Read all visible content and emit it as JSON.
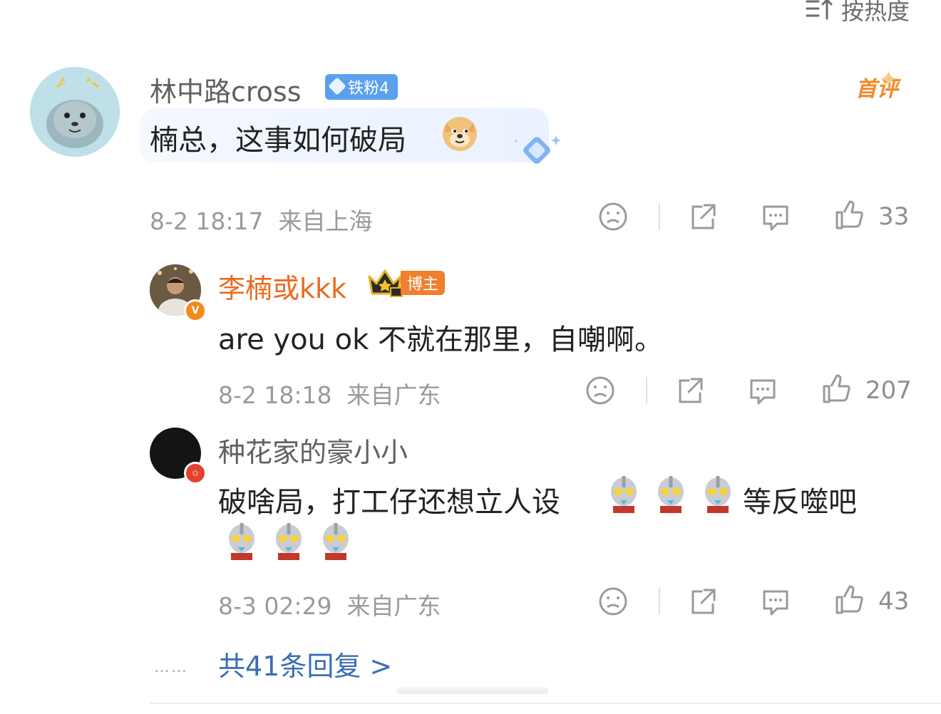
{
  "sort": {
    "label": "按热度"
  },
  "comments": [
    {
      "username": "林中路cross",
      "badge": "铁粉4",
      "tag": "首评",
      "text": "楠总，这事如何破局",
      "time": "8-2 18:17",
      "location": "来自上海",
      "likes": "33"
    },
    {
      "username": "李楠或kkk",
      "badge": "博主",
      "verified_label": "V",
      "text": "are you ok 不就在那里，自嘲啊。",
      "time": "8-2 18:18",
      "location": "来自广东",
      "likes": "207"
    },
    {
      "username": "种花家的豪小小",
      "text_line1": "破啥局，打工仔还想立人设",
      "text_line1_suffix": "等反噬吧",
      "time": "8-3 02:29",
      "location": "来自广东",
      "likes": "43"
    }
  ],
  "more_replies": "共41条回复 >",
  "dots": "……"
}
